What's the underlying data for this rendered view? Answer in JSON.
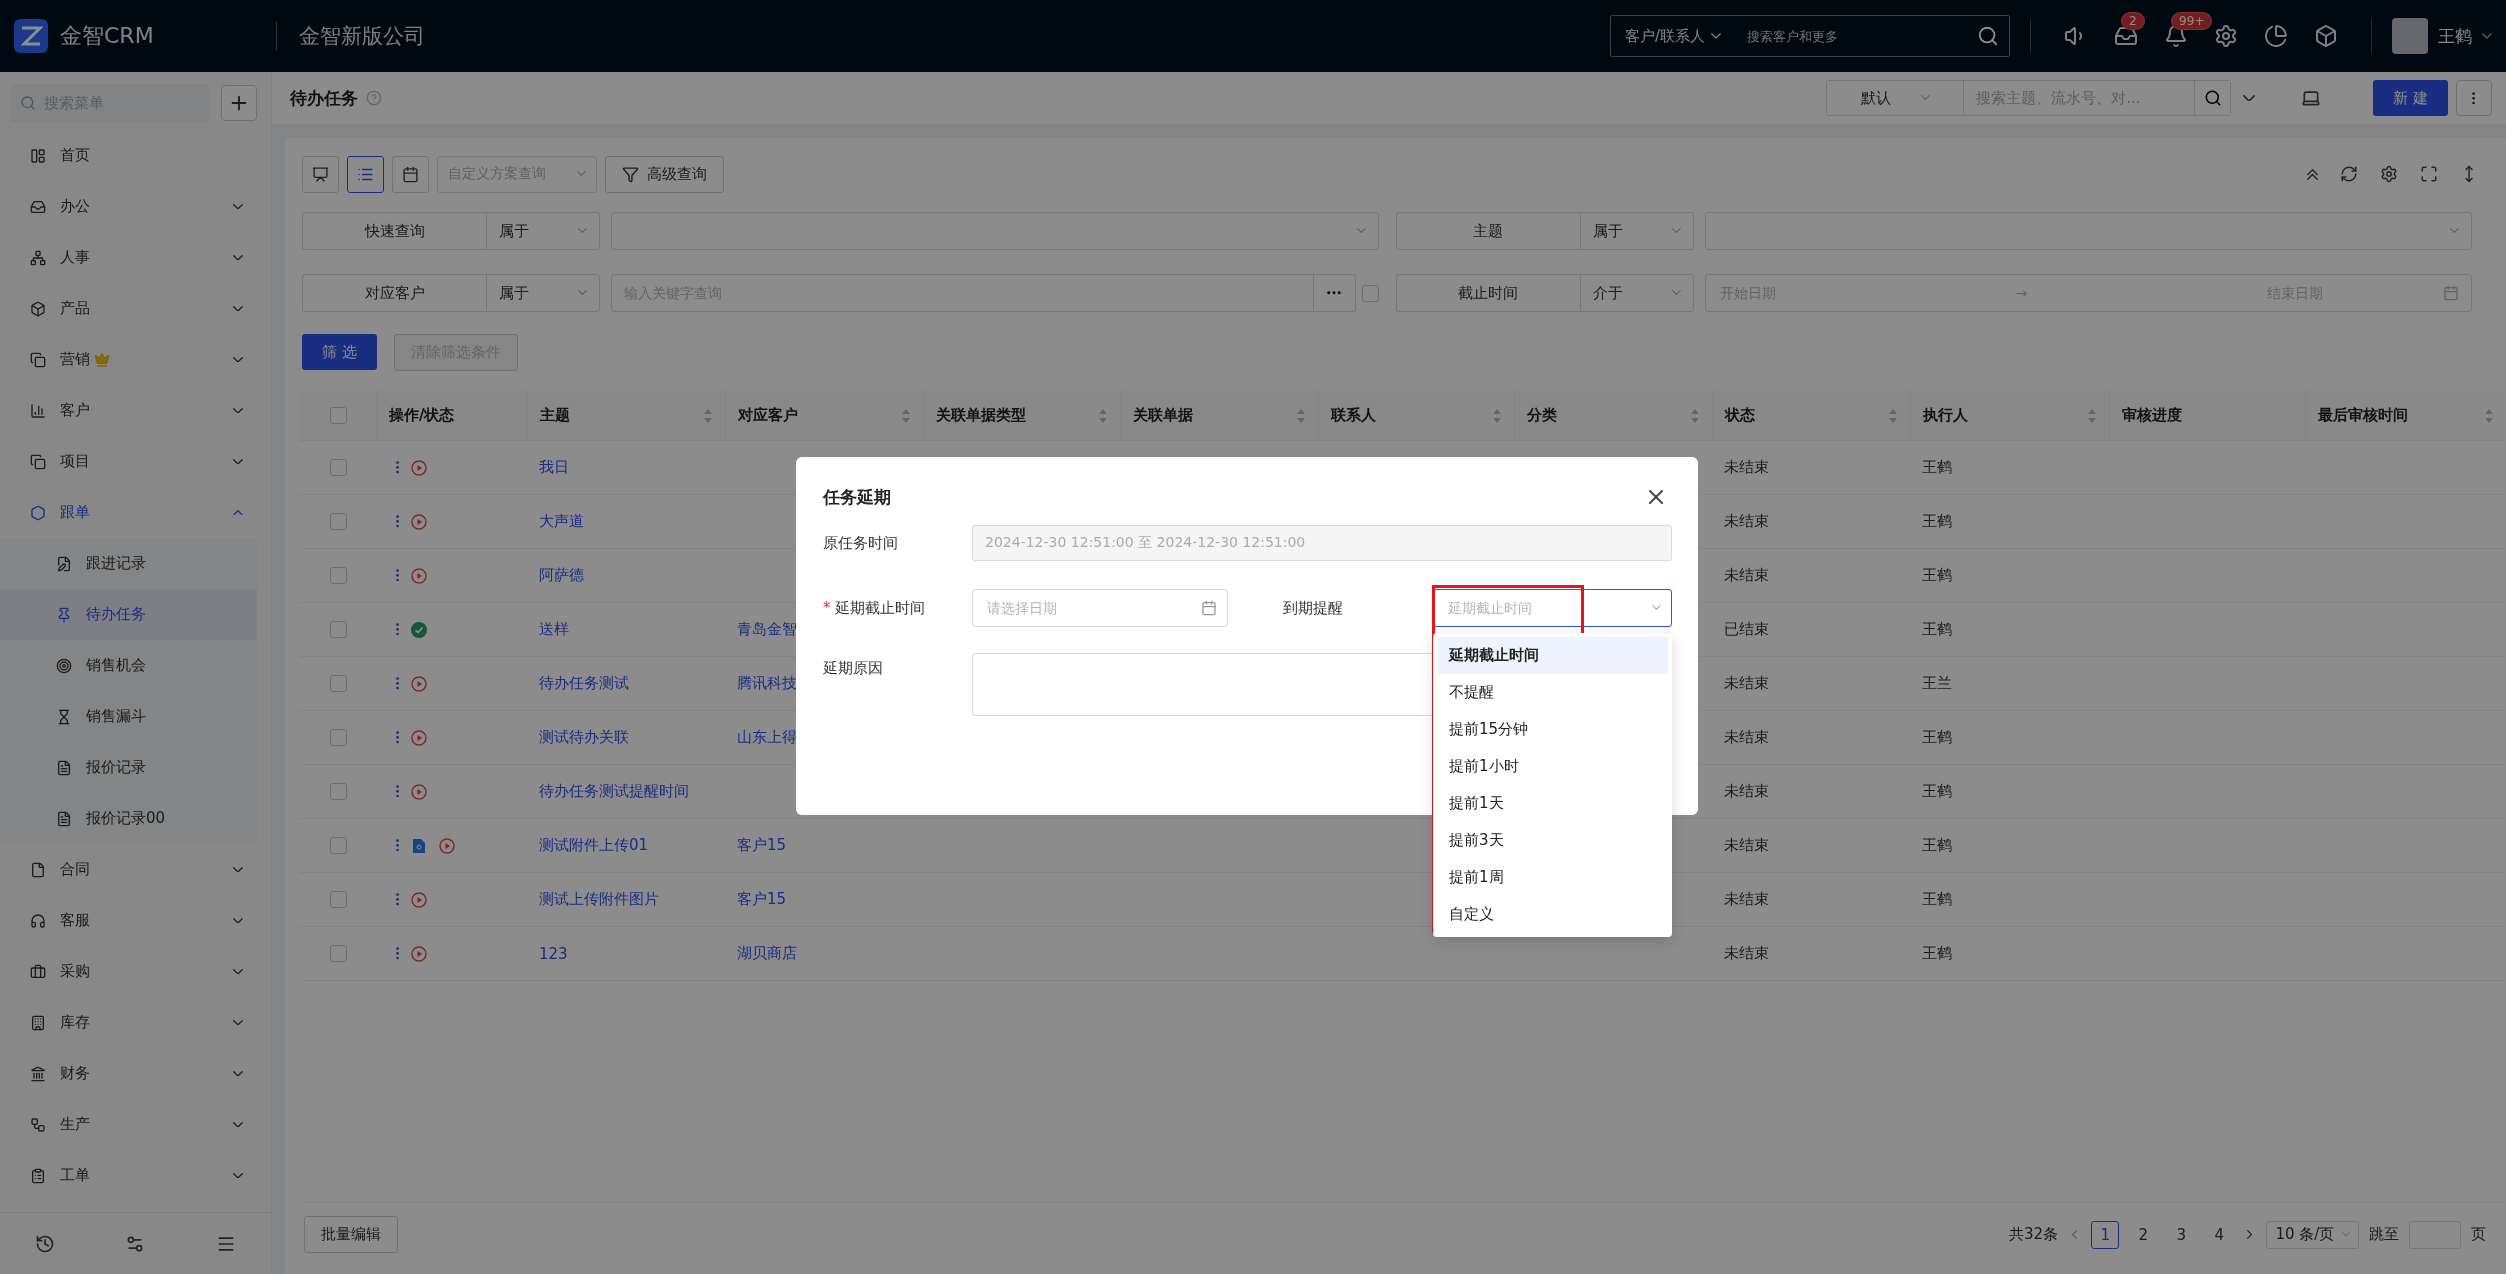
{
  "top_bar": {
    "logo": "金智CRM",
    "company": "金智新版公司",
    "search": {
      "scope": "客户/联系人",
      "placeholder": "搜索客户和更多"
    },
    "tools": [
      {
        "kind": "speaker"
      },
      {
        "kind": "inbox",
        "badge": "2"
      },
      {
        "kind": "bell",
        "badge": "99+"
      },
      {
        "kind": "settings"
      },
      {
        "kind": "chart"
      },
      {
        "kind": "cube"
      }
    ],
    "user": "王鹤"
  },
  "sidebar": {
    "search_placeholder": "搜索菜单",
    "items": [
      {
        "label": "首页",
        "kind": "link"
      },
      {
        "label": "办公",
        "kind": "group",
        "expanded": false,
        "active": false,
        "premium": false
      },
      {
        "label": "人事",
        "kind": "group",
        "expanded": false,
        "active": false,
        "premium": false
      },
      {
        "label": "产品",
        "kind": "group",
        "expanded": false,
        "active": false,
        "premium": false
      },
      {
        "label": "营销",
        "kind": "group",
        "expanded": false,
        "active": false,
        "premium": true
      },
      {
        "label": "客户",
        "kind": "group",
        "expanded": false,
        "active": false,
        "premium": false
      },
      {
        "label": "项目",
        "kind": "group",
        "expanded": false,
        "active": false,
        "premium": false
      },
      {
        "label": "跟单",
        "kind": "group",
        "expanded": true,
        "active": true,
        "premium": false,
        "children": [
          {
            "label": "跟进记录",
            "selected": false
          },
          {
            "label": "待办任务",
            "selected": true
          },
          {
            "label": "销售机会",
            "selected": false
          },
          {
            "label": "销售漏斗",
            "selected": false
          },
          {
            "label": "报价记录",
            "selected": false
          },
          {
            "label": "报价记录00",
            "selected": false
          }
        ]
      },
      {
        "label": "合同",
        "kind": "group",
        "expanded": false,
        "active": false,
        "premium": false
      },
      {
        "label": "客服",
        "kind": "group",
        "expanded": false,
        "active": false,
        "premium": false
      },
      {
        "label": "采购",
        "kind": "group",
        "expanded": false,
        "active": false,
        "premium": false
      },
      {
        "label": "库存",
        "kind": "group",
        "expanded": false,
        "active": false,
        "premium": false
      },
      {
        "label": "财务",
        "kind": "group",
        "expanded": false,
        "active": false,
        "premium": false
      },
      {
        "label": "生产",
        "kind": "group",
        "expanded": false,
        "active": false,
        "premium": false
      },
      {
        "label": "工单",
        "kind": "group",
        "expanded": false,
        "active": false,
        "premium": false
      }
    ]
  },
  "page": {
    "title": "待办任务",
    "view": "默认",
    "search_placeholder": "搜索主题、流水号、对...",
    "new_button": "新 建"
  },
  "toolbar": {
    "views": [
      {
        "kind": "board",
        "selected": false
      },
      {
        "kind": "list",
        "selected": true
      },
      {
        "kind": "calendar",
        "selected": false
      }
    ],
    "scheme_placeholder": "自定义方案查询",
    "advanced": "高级查询"
  },
  "filters": [
    {
      "kind": "select",
      "field": "快速查询",
      "operator": "属于"
    },
    {
      "kind": "select",
      "field": "主题",
      "operator": "属于"
    },
    {
      "kind": "text",
      "field": "对应客户",
      "operator": "属于",
      "placeholder": "输入关键字查询",
      "checked": false
    },
    {
      "kind": "date_range",
      "field": "截止时间",
      "operator": "介于",
      "start_placeholder": "开始日期",
      "separator": "→",
      "end_placeholder": "结束日期"
    }
  ],
  "filter_button": "筛 选",
  "clear_button": {
    "label": "清除筛选条件",
    "disabled": true
  },
  "table": {
    "all_selected": false,
    "columns": [
      {
        "label": "操作/状态",
        "sortable": false
      },
      {
        "label": "主题",
        "sortable": true
      },
      {
        "label": "对应客户",
        "sortable": true
      },
      {
        "label": "关联单据类型",
        "sortable": true
      },
      {
        "label": "关联单据",
        "sortable": true
      },
      {
        "label": "联系人",
        "sortable": true
      },
      {
        "label": "分类",
        "sortable": true
      },
      {
        "label": "状态",
        "sortable": true
      },
      {
        "label": "执行人",
        "sortable": true
      },
      {
        "label": "审核进度",
        "sortable": false
      },
      {
        "label": "最后审核时间",
        "sortable": true
      }
    ],
    "rows": [
      {
        "selected": false,
        "done": false,
        "attachment": false,
        "subject": "我日",
        "status": "未结束",
        "executor": "王鹤"
      },
      {
        "selected": false,
        "done": false,
        "attachment": false,
        "subject": "大声道",
        "status": "未结束",
        "executor": "王鹤"
      },
      {
        "selected": false,
        "done": false,
        "attachment": false,
        "subject": "阿萨德",
        "status": "未结束",
        "executor": "王鹤"
      },
      {
        "selected": false,
        "done": true,
        "attachment": false,
        "subject": "送样",
        "customer": "青岛金智",
        "status": "已结束",
        "executor": "王鹤"
      },
      {
        "selected": false,
        "done": false,
        "attachment": false,
        "subject": "待办任务测试",
        "customer": "腾讯科技",
        "status": "未结束",
        "executor": "王兰"
      },
      {
        "selected": false,
        "done": false,
        "attachment": false,
        "subject": "测试待办关联",
        "customer": "山东上得",
        "status": "未结束",
        "executor": "王鹤"
      },
      {
        "selected": false,
        "done": false,
        "attachment": false,
        "subject": "待办任务测试提醒时间",
        "status": "未结束",
        "executor": "王鹤"
      },
      {
        "selected": false,
        "done": false,
        "attachment": true,
        "subject": "测试附件上传01",
        "customer": "客户15",
        "status": "未结束",
        "executor": "王鹤"
      },
      {
        "selected": false,
        "done": false,
        "attachment": false,
        "subject": "测试上传附件图片",
        "customer": "客户15",
        "status": "未结束",
        "executor": "王鹤"
      },
      {
        "selected": false,
        "done": false,
        "attachment": false,
        "subject": "123",
        "customer": "湖贝商店",
        "status": "未结束",
        "executor": "王鹤"
      }
    ]
  },
  "footer": {
    "batch_edit": "批量编辑",
    "total": "共32条",
    "pages": [
      {
        "label": "1",
        "selected": true
      },
      {
        "label": "2",
        "selected": false
      },
      {
        "label": "3",
        "selected": false
      },
      {
        "label": "4",
        "selected": false
      }
    ],
    "page_size": "10 条/页",
    "jump_label": "跳至",
    "page_suffix": "页"
  },
  "modal": {
    "title": "任务延期",
    "original_time": {
      "label": "原任务时间",
      "value": "2024-12-30 12:51:00 至 2024-12-30 12:51:00"
    },
    "deadline": {
      "label": "延期截止时间",
      "required_mark": "*",
      "placeholder": "请选择日期"
    },
    "reminder": {
      "label": "到期提醒",
      "placeholder": "延期截止时间",
      "options": [
        {
          "label": "延期截止时间",
          "selected": true
        },
        {
          "label": "不提醒",
          "selected": false
        },
        {
          "label": "提前15分钟",
          "selected": false
        },
        {
          "label": "提前1小时",
          "selected": false
        },
        {
          "label": "提前1天",
          "selected": false
        },
        {
          "label": "提前3天",
          "selected": false
        },
        {
          "label": "提前1周",
          "selected": false
        },
        {
          "label": "自定义",
          "selected": false
        }
      ]
    },
    "reason": {
      "label": "延期原因"
    }
  }
}
